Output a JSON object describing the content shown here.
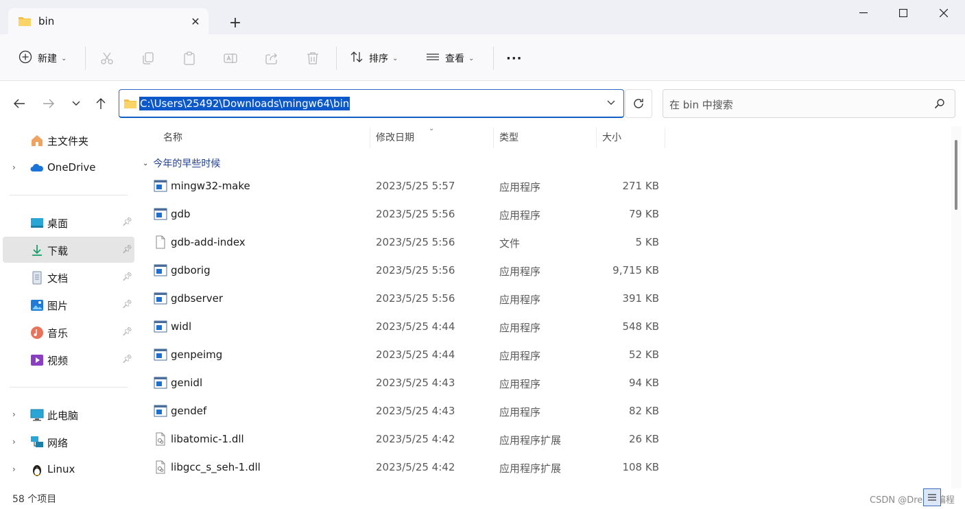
{
  "window": {
    "tab_title": "bin",
    "new_tab": "+",
    "minimize": "—",
    "maximize": "☐",
    "close": "✕"
  },
  "toolbar": {
    "new_label": "新建",
    "sort_label": "排序",
    "view_label": "查看",
    "more_label": "···",
    "icons": [
      "cut-icon",
      "copy-icon",
      "paste-icon",
      "rename-icon",
      "share-icon",
      "delete-icon"
    ]
  },
  "address": {
    "path": "C:\\Users\\25492\\Downloads\\mingw64\\bin",
    "search_placeholder": "在 bin 中搜索"
  },
  "sidebar": {
    "home": "主文件夹",
    "onedrive": "OneDrive",
    "desktop": "桌面",
    "downloads": "下载",
    "documents": "文档",
    "pictures": "图片",
    "music": "音乐",
    "videos": "视频",
    "thispc": "此电脑",
    "network": "网络",
    "linux": "Linux",
    "selected": "下载"
  },
  "columns": {
    "name": "名称",
    "date": "修改日期",
    "type": "类型",
    "size": "大小"
  },
  "group": {
    "label": "今年的早些时候"
  },
  "files": [
    {
      "name": "mingw32-make",
      "date": "2023/5/25 5:57",
      "type": "应用程序",
      "size": "271 KB",
      "kind": "exe"
    },
    {
      "name": "gdb",
      "date": "2023/5/25 5:56",
      "type": "应用程序",
      "size": "79 KB",
      "kind": "exe"
    },
    {
      "name": "gdb-add-index",
      "date": "2023/5/25 5:56",
      "type": "文件",
      "size": "5 KB",
      "kind": "file"
    },
    {
      "name": "gdborig",
      "date": "2023/5/25 5:56",
      "type": "应用程序",
      "size": "9,715 KB",
      "kind": "exe"
    },
    {
      "name": "gdbserver",
      "date": "2023/5/25 5:56",
      "type": "应用程序",
      "size": "391 KB",
      "kind": "exe"
    },
    {
      "name": "widl",
      "date": "2023/5/25 4:44",
      "type": "应用程序",
      "size": "548 KB",
      "kind": "exe"
    },
    {
      "name": "genpeimg",
      "date": "2023/5/25 4:44",
      "type": "应用程序",
      "size": "52 KB",
      "kind": "exe"
    },
    {
      "name": "genidl",
      "date": "2023/5/25 4:43",
      "type": "应用程序",
      "size": "94 KB",
      "kind": "exe"
    },
    {
      "name": "gendef",
      "date": "2023/5/25 4:43",
      "type": "应用程序",
      "size": "82 KB",
      "kind": "exe"
    },
    {
      "name": "libatomic-1.dll",
      "date": "2023/5/25 4:42",
      "type": "应用程序扩展",
      "size": "26 KB",
      "kind": "dll"
    },
    {
      "name": "libgcc_s_seh-1.dll",
      "date": "2023/5/25 4:42",
      "type": "应用程序扩展",
      "size": "108 KB",
      "kind": "dll"
    }
  ],
  "status": {
    "count": "58 个项目",
    "watermark": "CSDN @Dream编程"
  },
  "colors": {
    "accent": "#0a58ca",
    "group_text": "#1f3f8f",
    "selected_bg": "#e5e5e5"
  }
}
